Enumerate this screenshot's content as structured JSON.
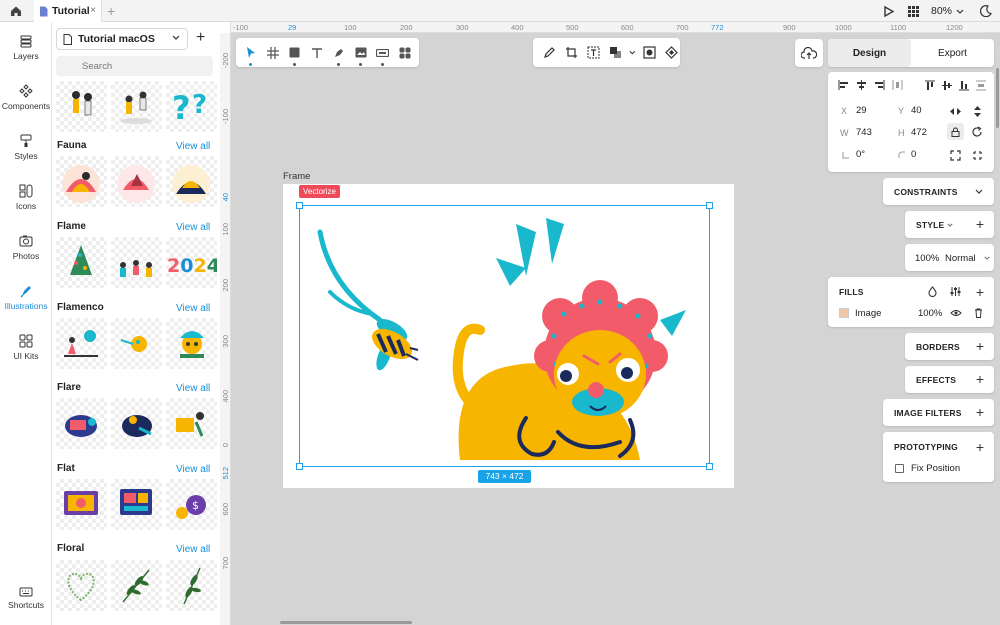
{
  "tab": {
    "title": "Tutorial",
    "close": "×",
    "add": "+"
  },
  "zoom": "80%",
  "leftnav": {
    "items": [
      {
        "label": "Layers",
        "icon": "layers-icon"
      },
      {
        "label": "Components",
        "icon": "components-icon"
      },
      {
        "label": "Styles",
        "icon": "styles-icon"
      },
      {
        "label": "Icons",
        "icon": "icons-icon"
      },
      {
        "label": "Photos",
        "icon": "photos-icon"
      },
      {
        "label": "Illustrations",
        "icon": "illustrations-icon",
        "active": true
      },
      {
        "label": "UI Kits",
        "icon": "ui-kits-icon"
      }
    ],
    "shortcuts": "Shortcuts"
  },
  "library": {
    "selected": "Tutorial macOS",
    "add": "+",
    "search_placeholder": "Search",
    "view_all": "View all",
    "categories": [
      "Fauna",
      "Flame",
      "Flamenco",
      "Flare",
      "Flat",
      "Floral"
    ]
  },
  "ruler": {
    "h": [
      "-100",
      "29",
      "100",
      "200",
      "300",
      "400",
      "500",
      "600",
      "700",
      "772",
      "900",
      "1000",
      "1100",
      "1200"
    ],
    "v": [
      "-200",
      "-100",
      "40",
      "100",
      "200",
      "300",
      "400",
      "0",
      "512",
      "600",
      "700"
    ]
  },
  "canvas": {
    "frame_label": "Frame",
    "badge": "Vectorize",
    "dims": "743 × 472"
  },
  "design": {
    "tabs": [
      "Design",
      "Export"
    ],
    "x_label": "X",
    "x": "29",
    "y_label": "Y",
    "y": "40",
    "w_label": "W",
    "w": "743",
    "h_label": "H",
    "h": "472",
    "rotation": "0°",
    "radius": "0",
    "constraints": "CONSTRAINTS",
    "style": "STYLE",
    "opacity": "100%",
    "blend": "Normal",
    "fills": "FILLS",
    "fill_name": "Image",
    "fill_opacity": "100%",
    "borders": "BORDERS",
    "effects": "EFFECTS",
    "image_filters": "IMAGE FILTERS",
    "prototyping": "PROTOTYPING",
    "fix_position": "Fix Position"
  },
  "colors": {
    "accent": "#1a8fd6",
    "selection": "#1aa3e8",
    "badge": "#ef4a5a",
    "lion": "#f8b500",
    "mane": "#f25c6a",
    "teal": "#1ab8cc"
  }
}
